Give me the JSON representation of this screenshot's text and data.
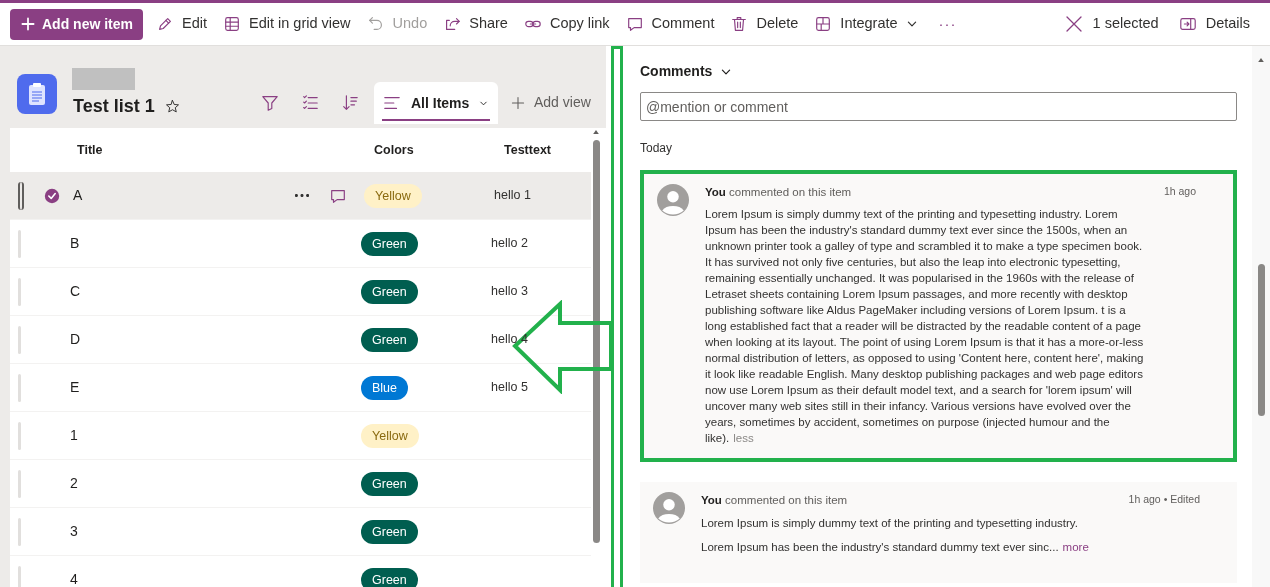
{
  "toolbar": {
    "commands": [
      {
        "kind": "add",
        "label": "Add new item",
        "disabled": false
      },
      {
        "kind": "edit",
        "label": "Edit",
        "disabled": false
      },
      {
        "kind": "grid",
        "label": "Edit in grid view",
        "disabled": false
      },
      {
        "kind": "undo",
        "label": "Undo",
        "disabled": true
      },
      {
        "kind": "share",
        "label": "Share",
        "disabled": false
      },
      {
        "kind": "link",
        "label": "Copy link",
        "disabled": false
      },
      {
        "kind": "comment",
        "label": "Comment",
        "disabled": false
      },
      {
        "kind": "delete",
        "label": "Delete",
        "disabled": false
      },
      {
        "kind": "integrate",
        "label": "Integrate",
        "disabled": false
      },
      {
        "kind": "more",
        "label": "···",
        "disabled": false
      }
    ],
    "selection": "1 selected",
    "details": "Details"
  },
  "list": {
    "title": "Test list 1",
    "view_tab": "All Items",
    "add_view": "Add view",
    "columns": [
      "Title",
      "Colors",
      "Testtext"
    ],
    "rows": [
      {
        "title": "A",
        "tag": "Yellow",
        "color": "#fff1c7",
        "text": "hello 1",
        "selected": true
      },
      {
        "title": "B",
        "tag": "Green",
        "color": "#005e50",
        "text": "hello 2",
        "selected": false
      },
      {
        "title": "C",
        "tag": "Green",
        "color": "#005e50",
        "text": "hello 3",
        "selected": false
      },
      {
        "title": "D",
        "tag": "Green",
        "color": "#005e50",
        "text": "hello 4",
        "selected": false
      },
      {
        "title": "E",
        "tag": "Blue",
        "color": "#0078d4",
        "text": "hello 5",
        "selected": false
      },
      {
        "title": "1",
        "tag": "Yellow",
        "color": "#fff1c7",
        "selected": false
      },
      {
        "title": "2",
        "tag": "Green",
        "color": "#005e50",
        "selected": false
      },
      {
        "title": "3",
        "tag": "Green",
        "color": "#005e50",
        "selected": false
      },
      {
        "title": "4",
        "tag": "Green",
        "color": "#005e50",
        "selected": false
      }
    ]
  },
  "comments_panel": {
    "heading": "Comments",
    "placeholder": "@mention or comment",
    "day": "Today",
    "comments": [
      {
        "author": "You",
        "action": "commented on this item",
        "time": "1h ago",
        "highlighted": true,
        "paragraphs": [
          "Lorem Ipsum is simply dummy text of the printing and typesetting industry. Lorem Ipsum has been the industry's standard dummy text ever since the 1500s, when an unknown printer took a galley of type and scrambled it to make a type specimen book. It has survived not only five centuries, but also the leap into electronic typesetting, remaining essentially unchanged. It was popularised in the 1960s with the release of Letraset sheets containing Lorem Ipsum passages, and more recently with desktop publishing software like Aldus PageMaker including versions of Lorem Ipsum. t is a long established fact that a reader will be distracted by the readable content of a page when looking at its layout. The point of using Lorem Ipsum is that it has a more-or-less normal distribution of letters, as opposed to using 'Content here, content here', making it look like readable English. Many desktop publishing packages and web page editors now use Lorem Ipsum as their default model text, and a search for 'lorem ipsum' will uncover many web sites still in their infancy. Various versions have evolved over the years, sometimes by accident, sometimes on purpose (injected humour and the like)."
        ],
        "toggle": "less"
      },
      {
        "author": "You",
        "action": "commented on this item",
        "time": "1h ago • Edited",
        "highlighted": false,
        "paragraphs": [
          "Lorem Ipsum is simply dummy text of the printing and typesetting industry.",
          "Lorem Ipsum has been the industry's standard dummy text ever sinc..."
        ],
        "toggle": "more"
      }
    ]
  }
}
